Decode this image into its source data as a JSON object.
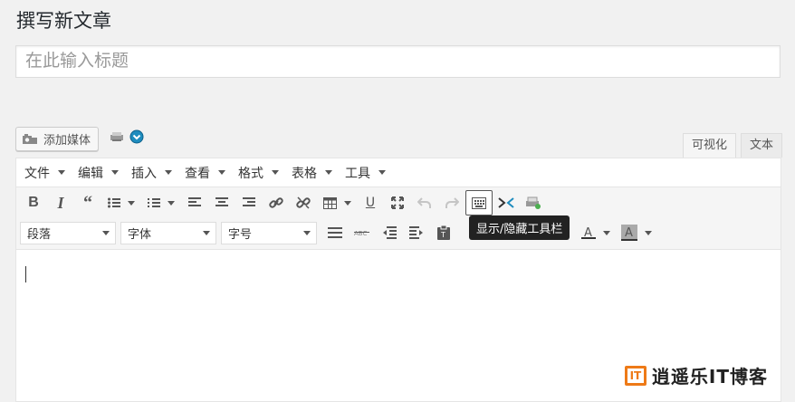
{
  "page": {
    "title": "撰写新文章"
  },
  "title_input": {
    "placeholder": "在此输入标题",
    "value": ""
  },
  "media": {
    "add_media_label": "添加媒体"
  },
  "mode_tabs": [
    {
      "label": "可视化"
    },
    {
      "label": "文本"
    }
  ],
  "menubar": {
    "items": [
      {
        "label": "文件"
      },
      {
        "label": "编辑"
      },
      {
        "label": "插入"
      },
      {
        "label": "查看"
      },
      {
        "label": "格式"
      },
      {
        "label": "表格"
      },
      {
        "label": "工具"
      }
    ]
  },
  "toolbar": {
    "row1_icons": [
      "bold-icon",
      "italic-icon",
      "blockquote-icon",
      "bullet-list-icon",
      "numbered-list-icon",
      "align-left-icon",
      "align-center-icon",
      "align-right-icon",
      "link-icon",
      "unlink-icon",
      "table-icon",
      "underline-icon",
      "fullscreen-icon",
      "undo-icon",
      "redo-icon",
      "toolbar-toggle-icon",
      "code-icon",
      "printer-icon"
    ],
    "row2": {
      "format_select": "段落",
      "font_select": "字体",
      "size_select": "字号",
      "icons": [
        "justify-icon",
        "strikethrough-icon",
        "outdent-icon",
        "indent-icon",
        "paste-text-icon",
        "emoticon-icon",
        "text-color-icon",
        "background-color-icon"
      ]
    },
    "tooltip": "显示/隐藏工具栏"
  },
  "watermark": {
    "logo_text": "IT",
    "text": "逍遥乐IT博客"
  },
  "colors": {
    "accent": "#ee7a17",
    "toolbar_active_border": "#555555"
  }
}
